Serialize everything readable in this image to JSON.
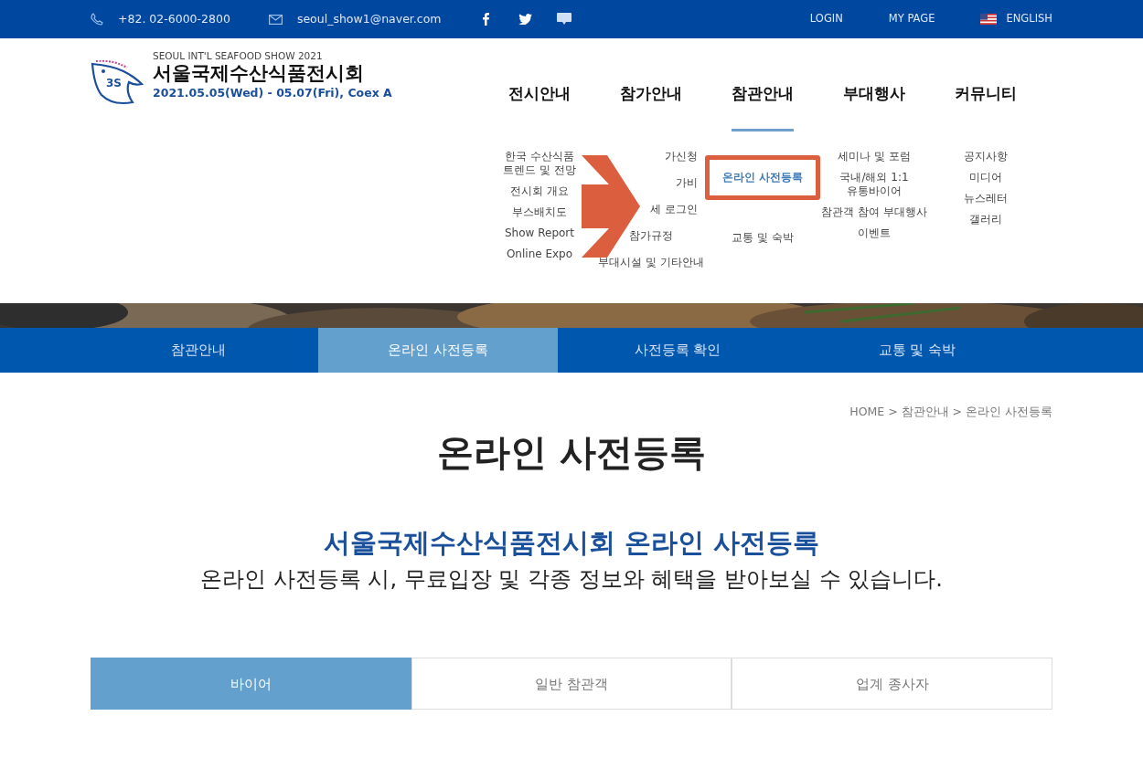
{
  "top_bar": {
    "phone": "+82. 02-6000-2800",
    "email": "seoul_show1@naver.com",
    "links": [
      {
        "label": "LOGIN",
        "kind": "text"
      },
      {
        "label": "MY PAGE",
        "kind": "text"
      },
      {
        "label": "ENGLISH",
        "kind": "flag"
      }
    ]
  },
  "logo": {
    "badge": "3S",
    "subtitle": "SEOUL INT'L SEAFOOD SHOW 2021",
    "title": "서울국제수산식품전시회",
    "dates": "2021.05.05(Wed) - 05.07(Fri), Coex A"
  },
  "menu": [
    {
      "label": "전시안내",
      "selected": false,
      "items": [
        {
          "label": "한국 수산식품 트렌드 및 전망",
          "selected": false
        },
        {
          "label": "전시회 개요",
          "selected": false
        },
        {
          "label": "부스배치도",
          "selected": false
        },
        {
          "label": "Show Report",
          "selected": false
        },
        {
          "label": "Online Expo",
          "selected": false
        }
      ]
    },
    {
      "label": "참가안내",
      "selected": false,
      "items": [
        {
          "label": "가신청",
          "selected": false
        },
        {
          "label": "가비",
          "selected": false
        },
        {
          "label": "세 로그인",
          "selected": false
        },
        {
          "label": "참가규정",
          "selected": false
        },
        {
          "label": "부대시설 및 기타안내",
          "selected": false
        }
      ]
    },
    {
      "label": "참관안내",
      "selected": true,
      "items": [
        {
          "label": "온라인 사전등록",
          "selected": true
        },
        {
          "label": "교통 및 숙박",
          "selected": false
        }
      ]
    },
    {
      "label": "부대행사",
      "selected": false,
      "items": [
        {
          "label": "세미나 및 포럼",
          "selected": false
        },
        {
          "label": "국내/해외 1:1 유통바이어",
          "selected": false
        },
        {
          "label": "참관객 참여 부대행사",
          "selected": false
        },
        {
          "label": "이벤트",
          "selected": false
        }
      ]
    },
    {
      "label": "커뮤니티",
      "selected": false,
      "items": [
        {
          "label": "공지사항",
          "selected": false
        },
        {
          "label": "미디어",
          "selected": false
        },
        {
          "label": "뉴스레터",
          "selected": false
        },
        {
          "label": "갤러리",
          "selected": false
        }
      ]
    }
  ],
  "sub_tabs": [
    {
      "label": "참관안내",
      "selected": false
    },
    {
      "label": "온라인 사전등록",
      "selected": true
    },
    {
      "label": "사전등록 확인",
      "selected": false
    },
    {
      "label": "교통 및 숙박",
      "selected": false
    }
  ],
  "breadcrumb": "HOME > 참관안내 > 온라인 사전등록",
  "page_title": "온라인 사전등록",
  "heading": "서울국제수산식품전시회 온라인 사전등록",
  "description": "온라인 사전등록 시, 무료입장 및 각종 정보와 혜택을 받아보실 수 있습니다.",
  "type_tabs": [
    {
      "label": "바이어",
      "selected": true
    },
    {
      "label": "일반 참관객",
      "selected": false
    },
    {
      "label": "업계 종사자",
      "selected": false
    }
  ]
}
